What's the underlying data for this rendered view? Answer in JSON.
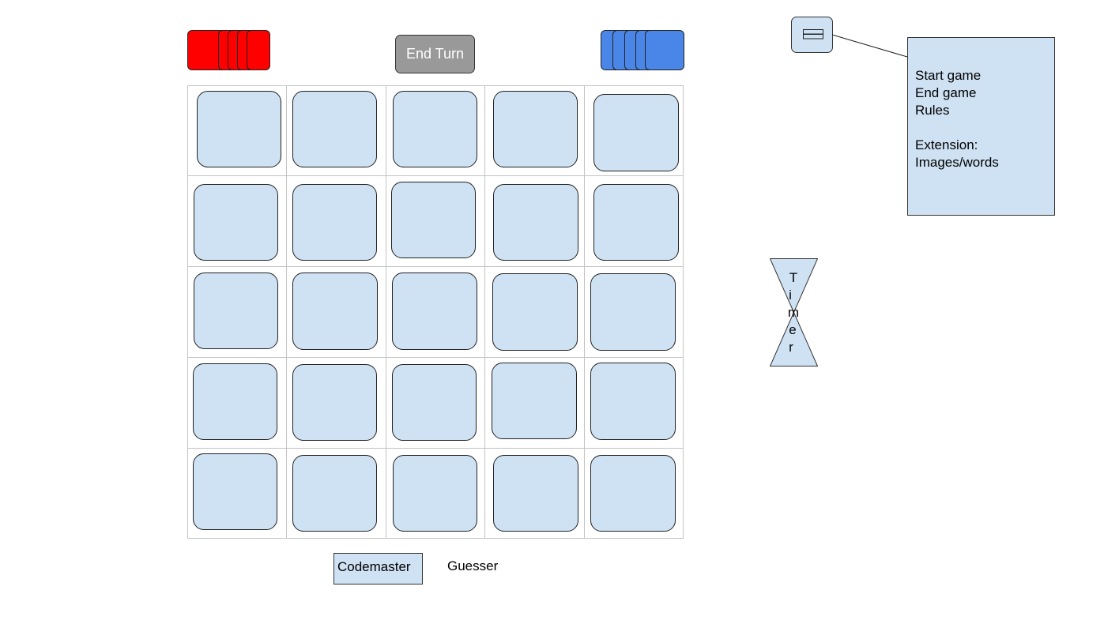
{
  "toolbar": {
    "end_turn_label": "End Turn"
  },
  "teams": {
    "red": {
      "color": "#ff0000",
      "cards_remaining": 5
    },
    "blue": {
      "color": "#4a86e8",
      "cards_remaining": 5
    }
  },
  "board": {
    "rows": 5,
    "columns": 5,
    "card_color": "#cfe2f3"
  },
  "menu": {
    "icon": "hamburger-menu-icon",
    "items": [
      "Start game",
      "End game",
      "Rules"
    ],
    "extension_heading": "Extension:",
    "extension_item": "Images/words"
  },
  "timer": {
    "icon": "hourglass-icon",
    "letters": [
      "T",
      "i",
      "m",
      "e",
      "r"
    ]
  },
  "roles": {
    "codemaster_label": "Codemaster",
    "guesser_label": "Guesser",
    "selected": "Codemaster"
  }
}
